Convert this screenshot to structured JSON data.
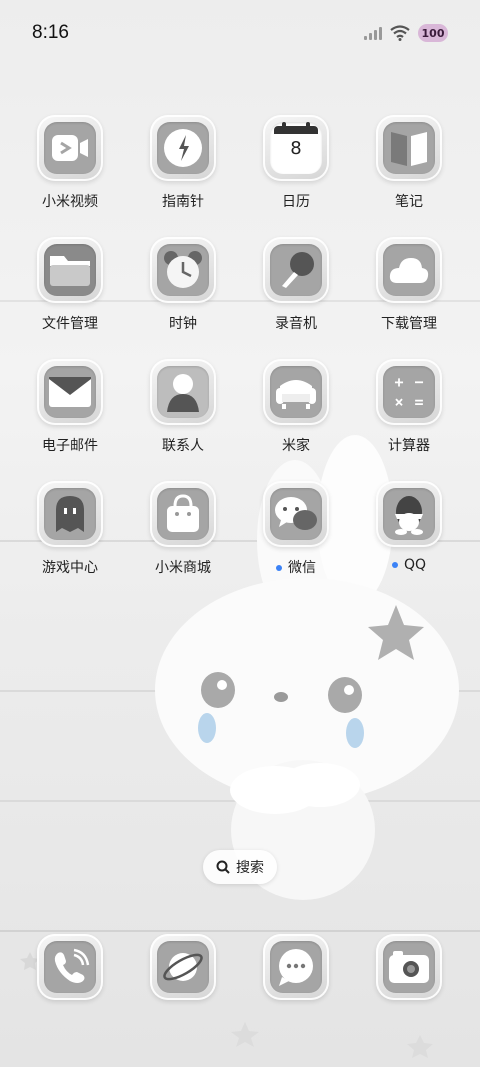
{
  "status_bar": {
    "time": "8:16",
    "battery": "100",
    "icons": [
      "signal-icon",
      "wifi-icon",
      "battery-icon"
    ]
  },
  "apps": [
    {
      "label": "小米视频",
      "icon": "video-icon"
    },
    {
      "label": "指南针",
      "icon": "compass-icon"
    },
    {
      "label": "日历",
      "icon": "calendar-icon",
      "calendar_day": "8"
    },
    {
      "label": "笔记",
      "icon": "notes-icon"
    },
    {
      "label": "文件管理",
      "icon": "folder-icon"
    },
    {
      "label": "时钟",
      "icon": "clock-icon"
    },
    {
      "label": "录音机",
      "icon": "microphone-icon"
    },
    {
      "label": "下载管理",
      "icon": "cloud-download-icon"
    },
    {
      "label": "电子邮件",
      "icon": "mail-icon"
    },
    {
      "label": "联系人",
      "icon": "contacts-icon"
    },
    {
      "label": "米家",
      "icon": "sofa-icon"
    },
    {
      "label": "计算器",
      "icon": "calculator-icon"
    },
    {
      "label": "游戏中心",
      "icon": "game-ghost-icon"
    },
    {
      "label": "小米商城",
      "icon": "shopping-bag-icon"
    },
    {
      "label": "微信",
      "icon": "wechat-icon",
      "badge": "new"
    },
    {
      "label": "QQ",
      "icon": "qq-penguin-icon",
      "badge": "new"
    }
  ],
  "search": {
    "label": "搜索"
  },
  "dock": [
    {
      "icon": "phone-icon"
    },
    {
      "icon": "browser-planet-icon"
    },
    {
      "icon": "messages-icon"
    },
    {
      "icon": "camera-icon"
    }
  ],
  "colors": {
    "badge_dot": "#3b82f6",
    "battery_bg": "#d9b7d8",
    "tile_inner": "#a5a5a5"
  }
}
